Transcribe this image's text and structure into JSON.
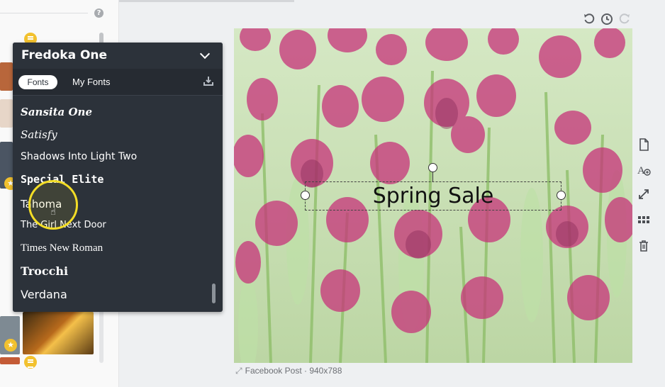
{
  "font_panel": {
    "selected_font": "Fredoka One",
    "tabs": [
      {
        "label": "Fonts",
        "active": true
      },
      {
        "label": "My Fonts",
        "active": false
      }
    ],
    "fonts": [
      {
        "name": "Sansita One"
      },
      {
        "name": "Satisfy"
      },
      {
        "name": "Shadows Into Light Two"
      },
      {
        "name": "Special Elite"
      },
      {
        "name": "Tahoma"
      },
      {
        "name": "The Girl Next Door"
      },
      {
        "name": "Times New Roman"
      },
      {
        "name": "Trocchi"
      },
      {
        "name": "Verdana"
      }
    ]
  },
  "canvas": {
    "text": "Spring Sale",
    "caption": "Facebook Post · 940x788"
  },
  "icons": {
    "undo": "undo-icon",
    "history": "history-icon",
    "redo": "redo-icon",
    "help": "help-icon",
    "download": "download-icon",
    "toolbar": [
      "page-icon",
      "add-text-icon",
      "resize-icon",
      "grid-icon",
      "trash-icon"
    ]
  },
  "colors": {
    "panel_bg": "#2c323a",
    "highlight": "#f3dd26",
    "accent_badge": "#f2c12e"
  }
}
